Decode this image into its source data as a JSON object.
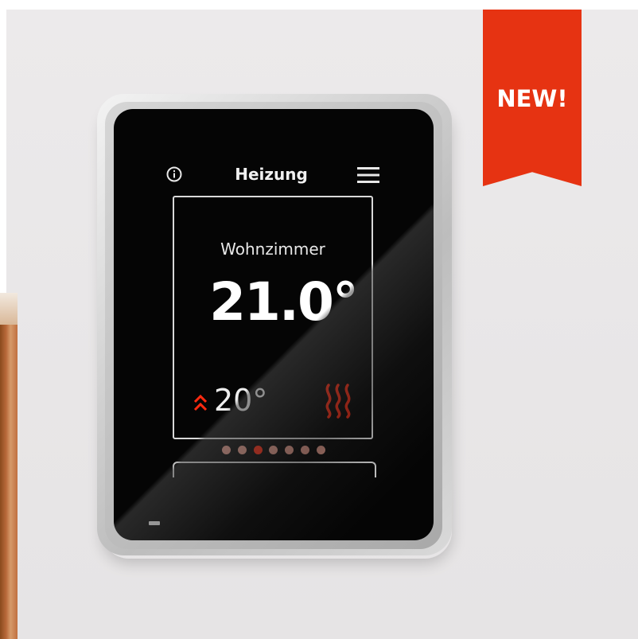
{
  "badge": {
    "label": "NEW!",
    "color": "#e63312"
  },
  "device": {
    "header": {
      "title": "Heizung",
      "left_icon": "info-icon",
      "right_icon": "menu-icon"
    },
    "room": {
      "name": "Wohnzimmer",
      "current_temperature": "21.0°",
      "setpoint_icon": "double-chevron-up-icon",
      "setpoint": "20°",
      "mode_icon": "heating-waves-icon"
    },
    "pager": {
      "total_pages": 7,
      "active_page": 3
    },
    "colors": {
      "screen": "#050505",
      "accent": "#ff2a10",
      "inactive_dot": "#e39a8a",
      "text": "#ffffff"
    }
  }
}
